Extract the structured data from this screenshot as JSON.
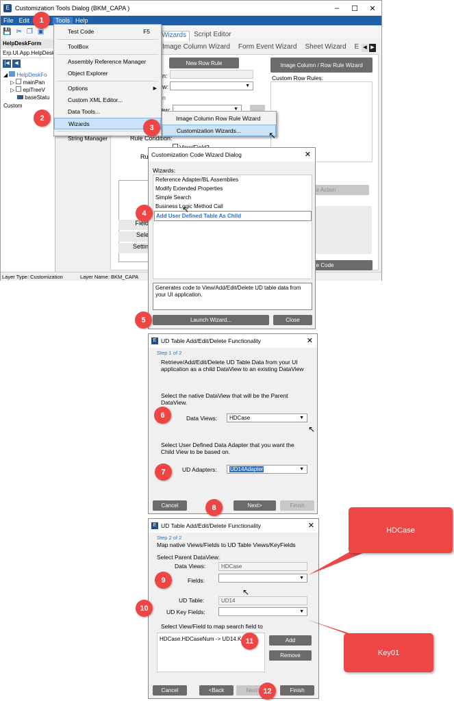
{
  "main_window": {
    "title": "Customization Tools Dialog  (BKM_CAPA )",
    "menu": [
      "File",
      "Edit",
      "Tools",
      "Help"
    ],
    "panel_title": "HelpDeskForm",
    "path": "Erp.UI.App.HelpDesk",
    "tree": [
      "HelpDeskFo",
      "mainPan",
      "epiTreeV",
      "baseStatu"
    ],
    "custom_label": "Custom",
    "tabs": [
      "Wizards",
      "Script Editor"
    ],
    "subtabs": [
      "Image Column Wizard",
      "Form Event Wizard",
      "Sheet Wizard",
      "E"
    ],
    "new_row_rule": "New Row Rule",
    "image_col_btn": "Image Column / Row Rule Wizard",
    "custom_row_rules": "Custom Row Rules:",
    "field_frags": [
      "n:",
      "w:",
      "ew:",
      "Rule Condition:",
      "Ru"
    ],
    "viewfield2": "View/Field2",
    "left_btns": [
      "Field",
      "Sele",
      "Settin"
    ],
    "right_btns": [
      "ate Action",
      "ate Code"
    ],
    "status_layer_type": "Layer Type:  Customization",
    "status_layer_name": "Layer Name:  BKM_CAPA"
  },
  "tools_menu": {
    "items": [
      {
        "label": "Test Code",
        "shortcut": "F5"
      },
      {
        "label": "ToolBox"
      },
      {
        "label": "Assembly Reference Manager"
      },
      {
        "label": "Object Explorer"
      },
      {
        "label": "Options"
      },
      {
        "label": "Custom XML Editor..."
      },
      {
        "label": "Data Tools..."
      },
      {
        "label": "Wizards"
      },
      {
        "label": "String Manager"
      }
    ]
  },
  "wizards_submenu": [
    "Image Column Row Rule Wizard",
    "Customization Wizards..."
  ],
  "code_wizard": {
    "title": "Customization Code Wizard Dialog",
    "wizards_label": "Wizards:",
    "items": [
      "Reference Adapter/BL Assemblies",
      "Modify Extended Properties",
      "Simple Search",
      "Business Logic Method Call",
      "Add User Defined Table As Child"
    ],
    "description": "Generates code to View/Add/Edit/Delete UD table data from your UI application.",
    "launch": "Launch Wizard...",
    "close": "Close"
  },
  "step1": {
    "title": "UD Table Add/Edit/Delete Functionality",
    "step": "Step 1 of 2",
    "intro": "Retrieve/Add/Edit/Delete UD Table Data from your UI application as a child DataView to an existing DataView",
    "select_parent": "Select the native DataView that will be the Parent DataView.",
    "data_views_label": "Data Views:",
    "data_views_value": "HDCase",
    "select_adapter": "Select User Defined Data Adapter that you want the Child View to be based on.",
    "ud_adapters_label": "UD Adapters:",
    "ud_adapters_value": "UD14Adapter",
    "cancel": "Cancel",
    "next": "Next>",
    "finish": "Finish"
  },
  "step2": {
    "title": "UD Table Add/Edit/Delete Functionality",
    "step": "Step 2 of 2",
    "intro": "Map native Views/Fields to UD Table Views/KeyFields",
    "select_parent": "Select Parent DataView:",
    "data_views_label": "Data Views:",
    "data_views_value": "HDCase",
    "fields_label": "Fields:",
    "ud_table_label": "UD Table:",
    "ud_table_value": "UD14",
    "ud_key_label": "UD Key Fields:",
    "select_map": "Select View/Field to map search field to",
    "mapping": "HDCase.HDCaseNum -> UD14.K",
    "add": "Add",
    "remove": "Remove",
    "cancel": "Cancel",
    "back": "<Back",
    "next": "Next>",
    "finish": "Finish"
  },
  "callouts": {
    "top": "HDCase",
    "bottom": "Key01"
  },
  "badges": [
    "1",
    "2",
    "3",
    "4",
    "5",
    "6",
    "7",
    "8",
    "9",
    "10",
    "11",
    "12"
  ],
  "colors": {
    "badge": "#ee4545",
    "menubar": "#1f5fa8",
    "button": "#6b6b6b",
    "highlight": "#cde3f8",
    "link": "#2a6fc9"
  }
}
